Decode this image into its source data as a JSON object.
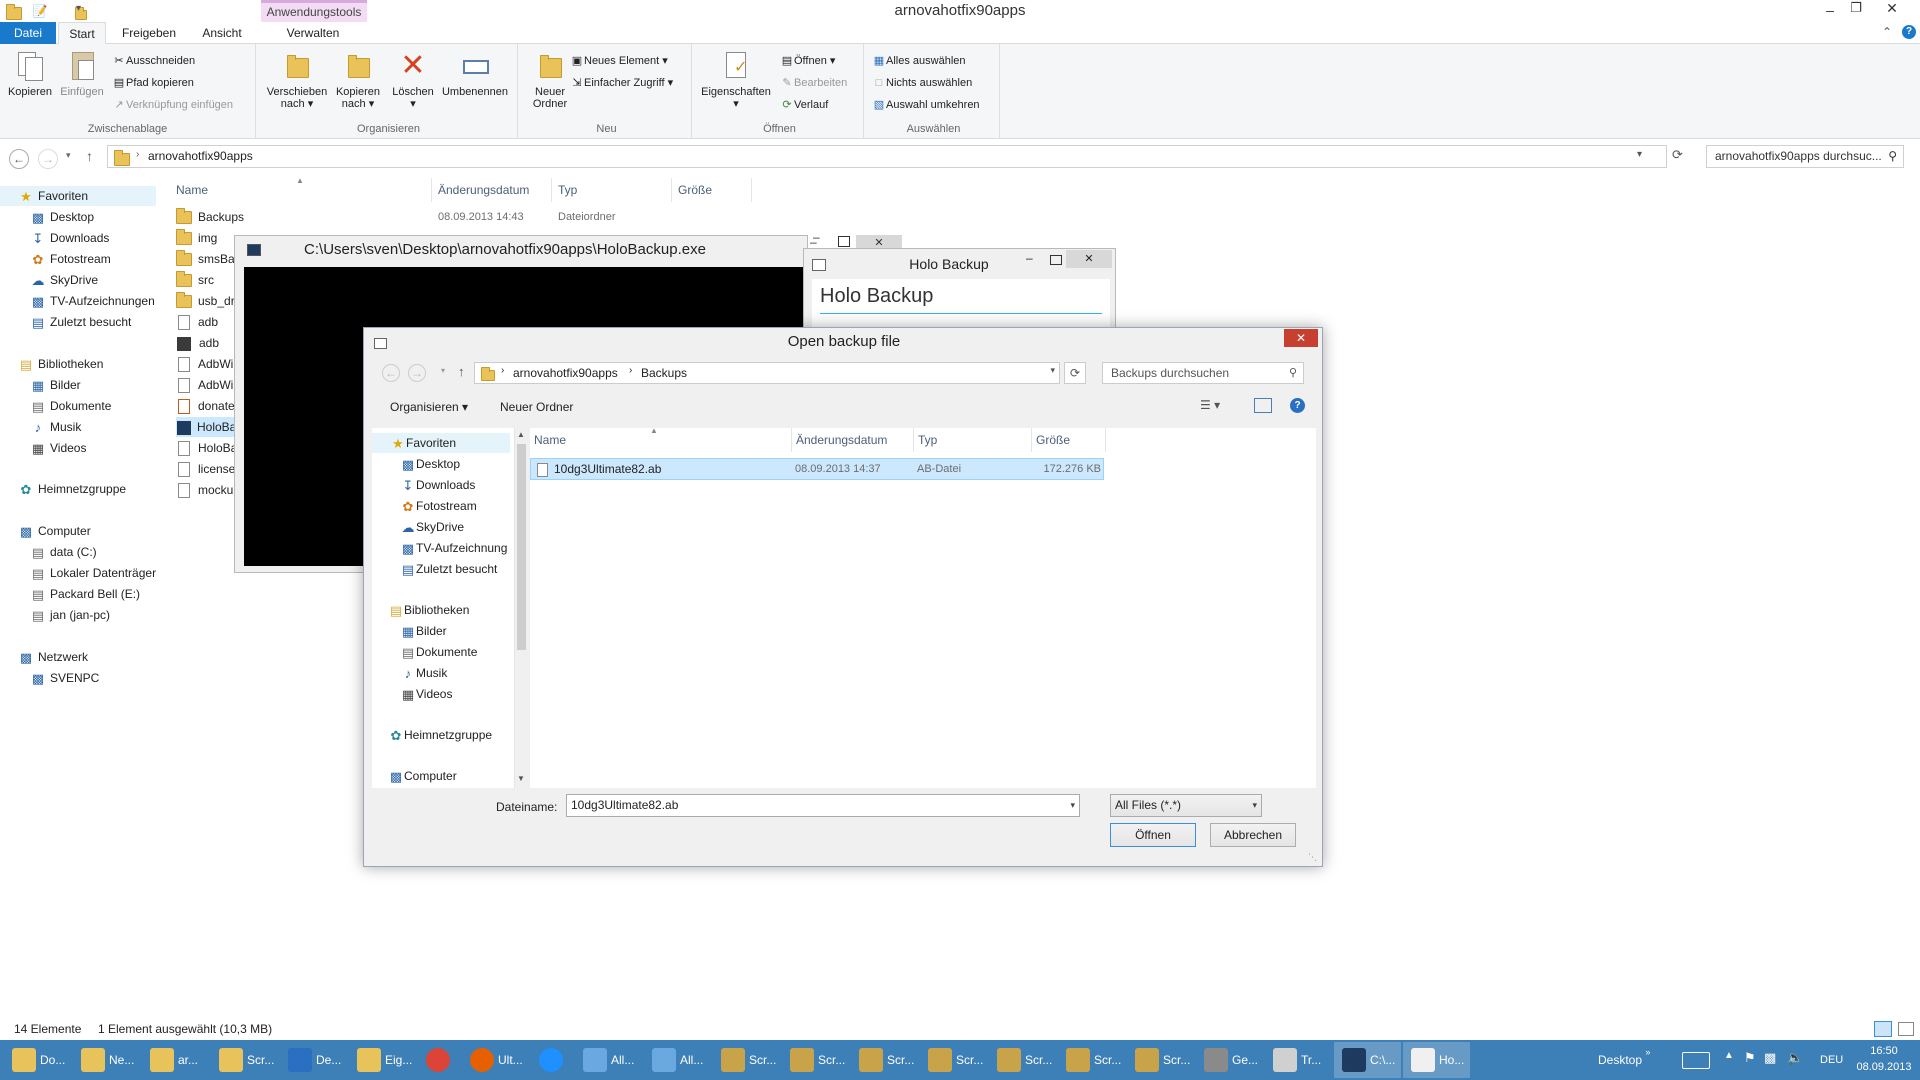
{
  "explorer": {
    "title": "arnovahotfix90apps",
    "context_tab_label": "Anwendungstools",
    "tabs": [
      "Datei",
      "Start",
      "Freigeben",
      "Ansicht",
      "Verwalten"
    ],
    "ribbon": {
      "clipboard": {
        "copy": "Kopieren",
        "paste": "Einfügen",
        "cut": "Ausschneiden",
        "copy_path": "Pfad kopieren",
        "paste_shortcut": "Verknüpfung einfügen",
        "label": "Zwischenablage"
      },
      "organize": {
        "move_to": "Verschieben nach",
        "copy_to": "Kopieren nach",
        "delete": "Löschen",
        "rename": "Umbenennen",
        "label": "Organisieren"
      },
      "new": {
        "new_folder": "Neuer Ordner",
        "new_item": "Neues Element",
        "easy_access": "Einfacher Zugriff",
        "label": "Neu"
      },
      "open": {
        "properties": "Eigenschaften",
        "open": "Öffnen",
        "edit": "Bearbeiten",
        "history": "Verlauf",
        "label": "Öffnen"
      },
      "select": {
        "select_all": "Alles auswählen",
        "select_none": "Nichts auswählen",
        "invert": "Auswahl umkehren",
        "label": "Auswählen"
      }
    },
    "address": "arnovahotfix90apps",
    "search_placeholder": "arnovahotfix90apps durchsuc...",
    "nav": {
      "favorites": "Favoriten",
      "fav_items": [
        "Desktop",
        "Downloads",
        "Fotostream",
        "SkyDrive",
        "TV-Aufzeichnungen",
        "Zuletzt besucht"
      ],
      "libraries": "Bibliotheken",
      "lib_items": [
        "Bilder",
        "Dokumente",
        "Musik",
        "Videos"
      ],
      "homegroup": "Heimnetzgruppe",
      "computer": "Computer",
      "comp_items": [
        "data (C:)",
        "Lokaler Datenträger",
        "Packard Bell (E:)",
        "jan (jan-pc)"
      ],
      "network": "Netzwerk",
      "net_items": [
        "SVENPC"
      ]
    },
    "columns": [
      "Name",
      "Änderungsdatum",
      "Typ",
      "Größe"
    ],
    "files": [
      {
        "name": "Backups",
        "date": "08.09.2013 14:43",
        "type": "Dateiordner"
      },
      {
        "name": "img"
      },
      {
        "name": "smsBa"
      },
      {
        "name": "src"
      },
      {
        "name": "usb_dr"
      },
      {
        "name": "adb"
      },
      {
        "name": "adb"
      },
      {
        "name": "AdbWi"
      },
      {
        "name": "AdbWi"
      },
      {
        "name": "donate"
      },
      {
        "name": "HoloBa"
      },
      {
        "name": "HoloBa"
      },
      {
        "name": "license"
      },
      {
        "name": "mocku"
      }
    ],
    "status_count": "14 Elemente",
    "status_selected": "1 Element ausgewählt (10,3 MB)"
  },
  "console": {
    "title": "C:\\Users\\sven\\Desktop\\arnovahotfix90apps\\HoloBackup.exe"
  },
  "holo": {
    "title": "Holo Backup",
    "heading": "Holo Backup"
  },
  "dialog": {
    "title": "Open backup file",
    "path": [
      "arnovahotfix90apps",
      "Backups"
    ],
    "search_placeholder": "Backups durchsuchen",
    "organize": "Organisieren",
    "new_folder": "Neuer Ordner",
    "nav": {
      "favorites": "Favoriten",
      "fav_items": [
        "Desktop",
        "Downloads",
        "Fotostream",
        "SkyDrive",
        "TV-Aufzeichnung",
        "Zuletzt besucht"
      ],
      "libraries": "Bibliotheken",
      "lib_items": [
        "Bilder",
        "Dokumente",
        "Musik",
        "Videos"
      ],
      "homegroup": "Heimnetzgruppe",
      "computer": "Computer"
    },
    "columns": [
      "Name",
      "Änderungsdatum",
      "Typ",
      "Größe"
    ],
    "file": {
      "name": "10dg3Ultimate82.ab",
      "date": "08.09.2013 14:37",
      "type": "AB-Datei",
      "size": "172.276 KB"
    },
    "filename_label": "Dateiname:",
    "filename_value": "10dg3Ultimate82.ab",
    "filter": "All Files (*.*)",
    "open_button": "Öffnen",
    "cancel_button": "Abbrechen"
  },
  "taskbar": {
    "items": [
      "Do...",
      "Ne...",
      "ar...",
      "Scr...",
      "De...",
      "Eig...",
      "",
      "Ult...",
      "",
      "All...",
      "All...",
      "Scr...",
      "Scr...",
      "Scr...",
      "Scr...",
      "Scr...",
      "Scr...",
      "Scr...",
      "Ge...",
      "Tr...",
      "C:\\...",
      "Ho..."
    ],
    "desktop_label": "Desktop",
    "language": "DEU",
    "time": "16:50",
    "date": "08.09.2013"
  }
}
